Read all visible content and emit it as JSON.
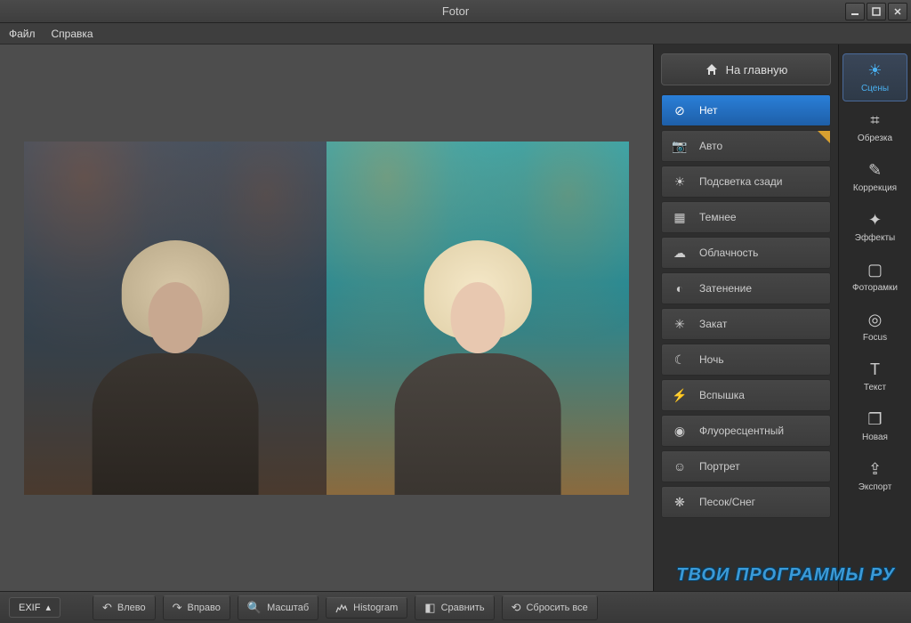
{
  "app_title": "Fotor",
  "menu": {
    "file": "Файл",
    "help": "Справка"
  },
  "home_button": "На главную",
  "scenes": [
    {
      "label": "Нет",
      "icon": "⊘",
      "active": true
    },
    {
      "label": "Авто",
      "icon": "📷",
      "starred": true
    },
    {
      "label": "Подсветка сзади",
      "icon": "☀"
    },
    {
      "label": "Темнее",
      "icon": "▦"
    },
    {
      "label": "Облачность",
      "icon": "☁"
    },
    {
      "label": "Затенение",
      "icon": "◐"
    },
    {
      "label": "Закат",
      "icon": "✳"
    },
    {
      "label": "Ночь",
      "icon": "☾"
    },
    {
      "label": "Вспышка",
      "icon": "⚡"
    },
    {
      "label": "Флуоресцентный",
      "icon": "◉"
    },
    {
      "label": "Портрет",
      "icon": "☺"
    },
    {
      "label": "Песок/Снег",
      "icon": "❋"
    }
  ],
  "tools": [
    {
      "label": "Сцены",
      "icon": "☀",
      "active": true
    },
    {
      "label": "Обрезка",
      "icon": "⌗"
    },
    {
      "label": "Коррекция",
      "icon": "✎"
    },
    {
      "label": "Эффекты",
      "icon": "✦"
    },
    {
      "label": "Фоторамки",
      "icon": "▢"
    },
    {
      "label": "Focus",
      "icon": "◎"
    },
    {
      "label": "Текст",
      "icon": "T"
    },
    {
      "label": "Новая",
      "icon": "❐"
    },
    {
      "label": "Экспорт",
      "icon": "⇪"
    }
  ],
  "bottom": {
    "exif": "EXIF",
    "rotate_left": "Влево",
    "rotate_right": "Вправо",
    "zoom": "Масштаб",
    "histogram": "Histogram",
    "compare": "Сравнить",
    "reset": "Сбросить все"
  },
  "watermark": "ТВОИ ПРОГРАММЫ РУ"
}
